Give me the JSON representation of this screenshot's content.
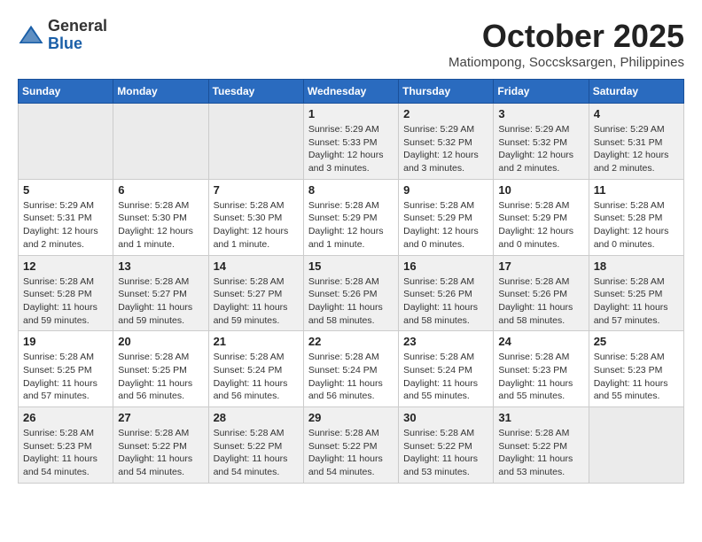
{
  "header": {
    "logo": {
      "general": "General",
      "blue": "Blue"
    },
    "title": "October 2025",
    "location": "Matiompong, Soccsksargen, Philippines"
  },
  "days_of_week": [
    "Sunday",
    "Monday",
    "Tuesday",
    "Wednesday",
    "Thursday",
    "Friday",
    "Saturday"
  ],
  "weeks": [
    [
      {
        "day": "",
        "empty": true
      },
      {
        "day": "",
        "empty": true
      },
      {
        "day": "",
        "empty": true
      },
      {
        "day": "1",
        "sunrise": "Sunrise: 5:29 AM",
        "sunset": "Sunset: 5:33 PM",
        "daylight": "Daylight: 12 hours and 3 minutes."
      },
      {
        "day": "2",
        "sunrise": "Sunrise: 5:29 AM",
        "sunset": "Sunset: 5:32 PM",
        "daylight": "Daylight: 12 hours and 3 minutes."
      },
      {
        "day": "3",
        "sunrise": "Sunrise: 5:29 AM",
        "sunset": "Sunset: 5:32 PM",
        "daylight": "Daylight: 12 hours and 2 minutes."
      },
      {
        "day": "4",
        "sunrise": "Sunrise: 5:29 AM",
        "sunset": "Sunset: 5:31 PM",
        "daylight": "Daylight: 12 hours and 2 minutes."
      }
    ],
    [
      {
        "day": "5",
        "sunrise": "Sunrise: 5:29 AM",
        "sunset": "Sunset: 5:31 PM",
        "daylight": "Daylight: 12 hours and 2 minutes."
      },
      {
        "day": "6",
        "sunrise": "Sunrise: 5:28 AM",
        "sunset": "Sunset: 5:30 PM",
        "daylight": "Daylight: 12 hours and 1 minute."
      },
      {
        "day": "7",
        "sunrise": "Sunrise: 5:28 AM",
        "sunset": "Sunset: 5:30 PM",
        "daylight": "Daylight: 12 hours and 1 minute."
      },
      {
        "day": "8",
        "sunrise": "Sunrise: 5:28 AM",
        "sunset": "Sunset: 5:29 PM",
        "daylight": "Daylight: 12 hours and 1 minute."
      },
      {
        "day": "9",
        "sunrise": "Sunrise: 5:28 AM",
        "sunset": "Sunset: 5:29 PM",
        "daylight": "Daylight: 12 hours and 0 minutes."
      },
      {
        "day": "10",
        "sunrise": "Sunrise: 5:28 AM",
        "sunset": "Sunset: 5:29 PM",
        "daylight": "Daylight: 12 hours and 0 minutes."
      },
      {
        "day": "11",
        "sunrise": "Sunrise: 5:28 AM",
        "sunset": "Sunset: 5:28 PM",
        "daylight": "Daylight: 12 hours and 0 minutes."
      }
    ],
    [
      {
        "day": "12",
        "sunrise": "Sunrise: 5:28 AM",
        "sunset": "Sunset: 5:28 PM",
        "daylight": "Daylight: 11 hours and 59 minutes."
      },
      {
        "day": "13",
        "sunrise": "Sunrise: 5:28 AM",
        "sunset": "Sunset: 5:27 PM",
        "daylight": "Daylight: 11 hours and 59 minutes."
      },
      {
        "day": "14",
        "sunrise": "Sunrise: 5:28 AM",
        "sunset": "Sunset: 5:27 PM",
        "daylight": "Daylight: 11 hours and 59 minutes."
      },
      {
        "day": "15",
        "sunrise": "Sunrise: 5:28 AM",
        "sunset": "Sunset: 5:26 PM",
        "daylight": "Daylight: 11 hours and 58 minutes."
      },
      {
        "day": "16",
        "sunrise": "Sunrise: 5:28 AM",
        "sunset": "Sunset: 5:26 PM",
        "daylight": "Daylight: 11 hours and 58 minutes."
      },
      {
        "day": "17",
        "sunrise": "Sunrise: 5:28 AM",
        "sunset": "Sunset: 5:26 PM",
        "daylight": "Daylight: 11 hours and 58 minutes."
      },
      {
        "day": "18",
        "sunrise": "Sunrise: 5:28 AM",
        "sunset": "Sunset: 5:25 PM",
        "daylight": "Daylight: 11 hours and 57 minutes."
      }
    ],
    [
      {
        "day": "19",
        "sunrise": "Sunrise: 5:28 AM",
        "sunset": "Sunset: 5:25 PM",
        "daylight": "Daylight: 11 hours and 57 minutes."
      },
      {
        "day": "20",
        "sunrise": "Sunrise: 5:28 AM",
        "sunset": "Sunset: 5:25 PM",
        "daylight": "Daylight: 11 hours and 56 minutes."
      },
      {
        "day": "21",
        "sunrise": "Sunrise: 5:28 AM",
        "sunset": "Sunset: 5:24 PM",
        "daylight": "Daylight: 11 hours and 56 minutes."
      },
      {
        "day": "22",
        "sunrise": "Sunrise: 5:28 AM",
        "sunset": "Sunset: 5:24 PM",
        "daylight": "Daylight: 11 hours and 56 minutes."
      },
      {
        "day": "23",
        "sunrise": "Sunrise: 5:28 AM",
        "sunset": "Sunset: 5:24 PM",
        "daylight": "Daylight: 11 hours and 55 minutes."
      },
      {
        "day": "24",
        "sunrise": "Sunrise: 5:28 AM",
        "sunset": "Sunset: 5:23 PM",
        "daylight": "Daylight: 11 hours and 55 minutes."
      },
      {
        "day": "25",
        "sunrise": "Sunrise: 5:28 AM",
        "sunset": "Sunset: 5:23 PM",
        "daylight": "Daylight: 11 hours and 55 minutes."
      }
    ],
    [
      {
        "day": "26",
        "sunrise": "Sunrise: 5:28 AM",
        "sunset": "Sunset: 5:23 PM",
        "daylight": "Daylight: 11 hours and 54 minutes."
      },
      {
        "day": "27",
        "sunrise": "Sunrise: 5:28 AM",
        "sunset": "Sunset: 5:22 PM",
        "daylight": "Daylight: 11 hours and 54 minutes."
      },
      {
        "day": "28",
        "sunrise": "Sunrise: 5:28 AM",
        "sunset": "Sunset: 5:22 PM",
        "daylight": "Daylight: 11 hours and 54 minutes."
      },
      {
        "day": "29",
        "sunrise": "Sunrise: 5:28 AM",
        "sunset": "Sunset: 5:22 PM",
        "daylight": "Daylight: 11 hours and 54 minutes."
      },
      {
        "day": "30",
        "sunrise": "Sunrise: 5:28 AM",
        "sunset": "Sunset: 5:22 PM",
        "daylight": "Daylight: 11 hours and 53 minutes."
      },
      {
        "day": "31",
        "sunrise": "Sunrise: 5:28 AM",
        "sunset": "Sunset: 5:22 PM",
        "daylight": "Daylight: 11 hours and 53 minutes."
      },
      {
        "day": "",
        "empty": true
      }
    ]
  ]
}
